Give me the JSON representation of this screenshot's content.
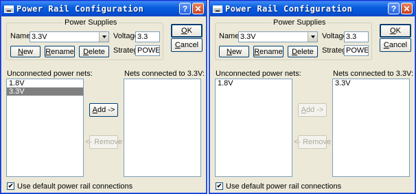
{
  "dialogs": [
    {
      "title": "Power Rail Configuration",
      "group_label": "Power Supplies",
      "name_label": "Name",
      "name_value": "3.3V",
      "voltage_label": "Voltage",
      "voltage_value": "3.3",
      "strategy_label": "Strateg",
      "strategy_value": "POWER",
      "new_label": "New",
      "rename_label": "Rename",
      "delete_label": "Delete",
      "ok_label": "OK",
      "cancel_label": "Cancel",
      "unconnected_label": "Unconnected power nets:",
      "connected_label": "Nets connected to 3.3V:",
      "unconnected_items": [
        "1.8V",
        "3.3V"
      ],
      "selected_unconnected": "3.3V",
      "connected_items": [],
      "add_label": "Add ->",
      "remove_label": "<- Remove",
      "add_enabled": true,
      "remove_enabled": false,
      "checkbox_label": "Use default power rail connections",
      "checkbox_checked": true
    },
    {
      "title": "Power Rail Configuration",
      "group_label": "Power Supplies",
      "name_label": "Name",
      "name_value": "3.3V",
      "voltage_label": "Voltage",
      "voltage_value": "3.3",
      "strategy_label": "Strateg",
      "strategy_value": "POWER",
      "new_label": "New",
      "rename_label": "Rename",
      "delete_label": "Delete",
      "ok_label": "OK",
      "cancel_label": "Cancel",
      "unconnected_label": "Unconnected power nets:",
      "connected_label": "Nets connected to 3.3V:",
      "unconnected_items": [
        "1.8V"
      ],
      "selected_unconnected": "",
      "connected_items": [
        "3.3V"
      ],
      "add_label": "Add ->",
      "remove_label": "<- Remove",
      "add_enabled": false,
      "remove_enabled": false,
      "checkbox_label": "Use default power rail connections",
      "checkbox_checked": true
    }
  ],
  "icons": {
    "window": "app-icon",
    "help": "help-icon",
    "close": "close-icon",
    "dropdown": "chevron-down-icon",
    "check": "checkmark-icon"
  },
  "colors": {
    "titlebar": "#0a5ddd",
    "dialog_bg": "#ece9d8",
    "selection": "#808080"
  }
}
